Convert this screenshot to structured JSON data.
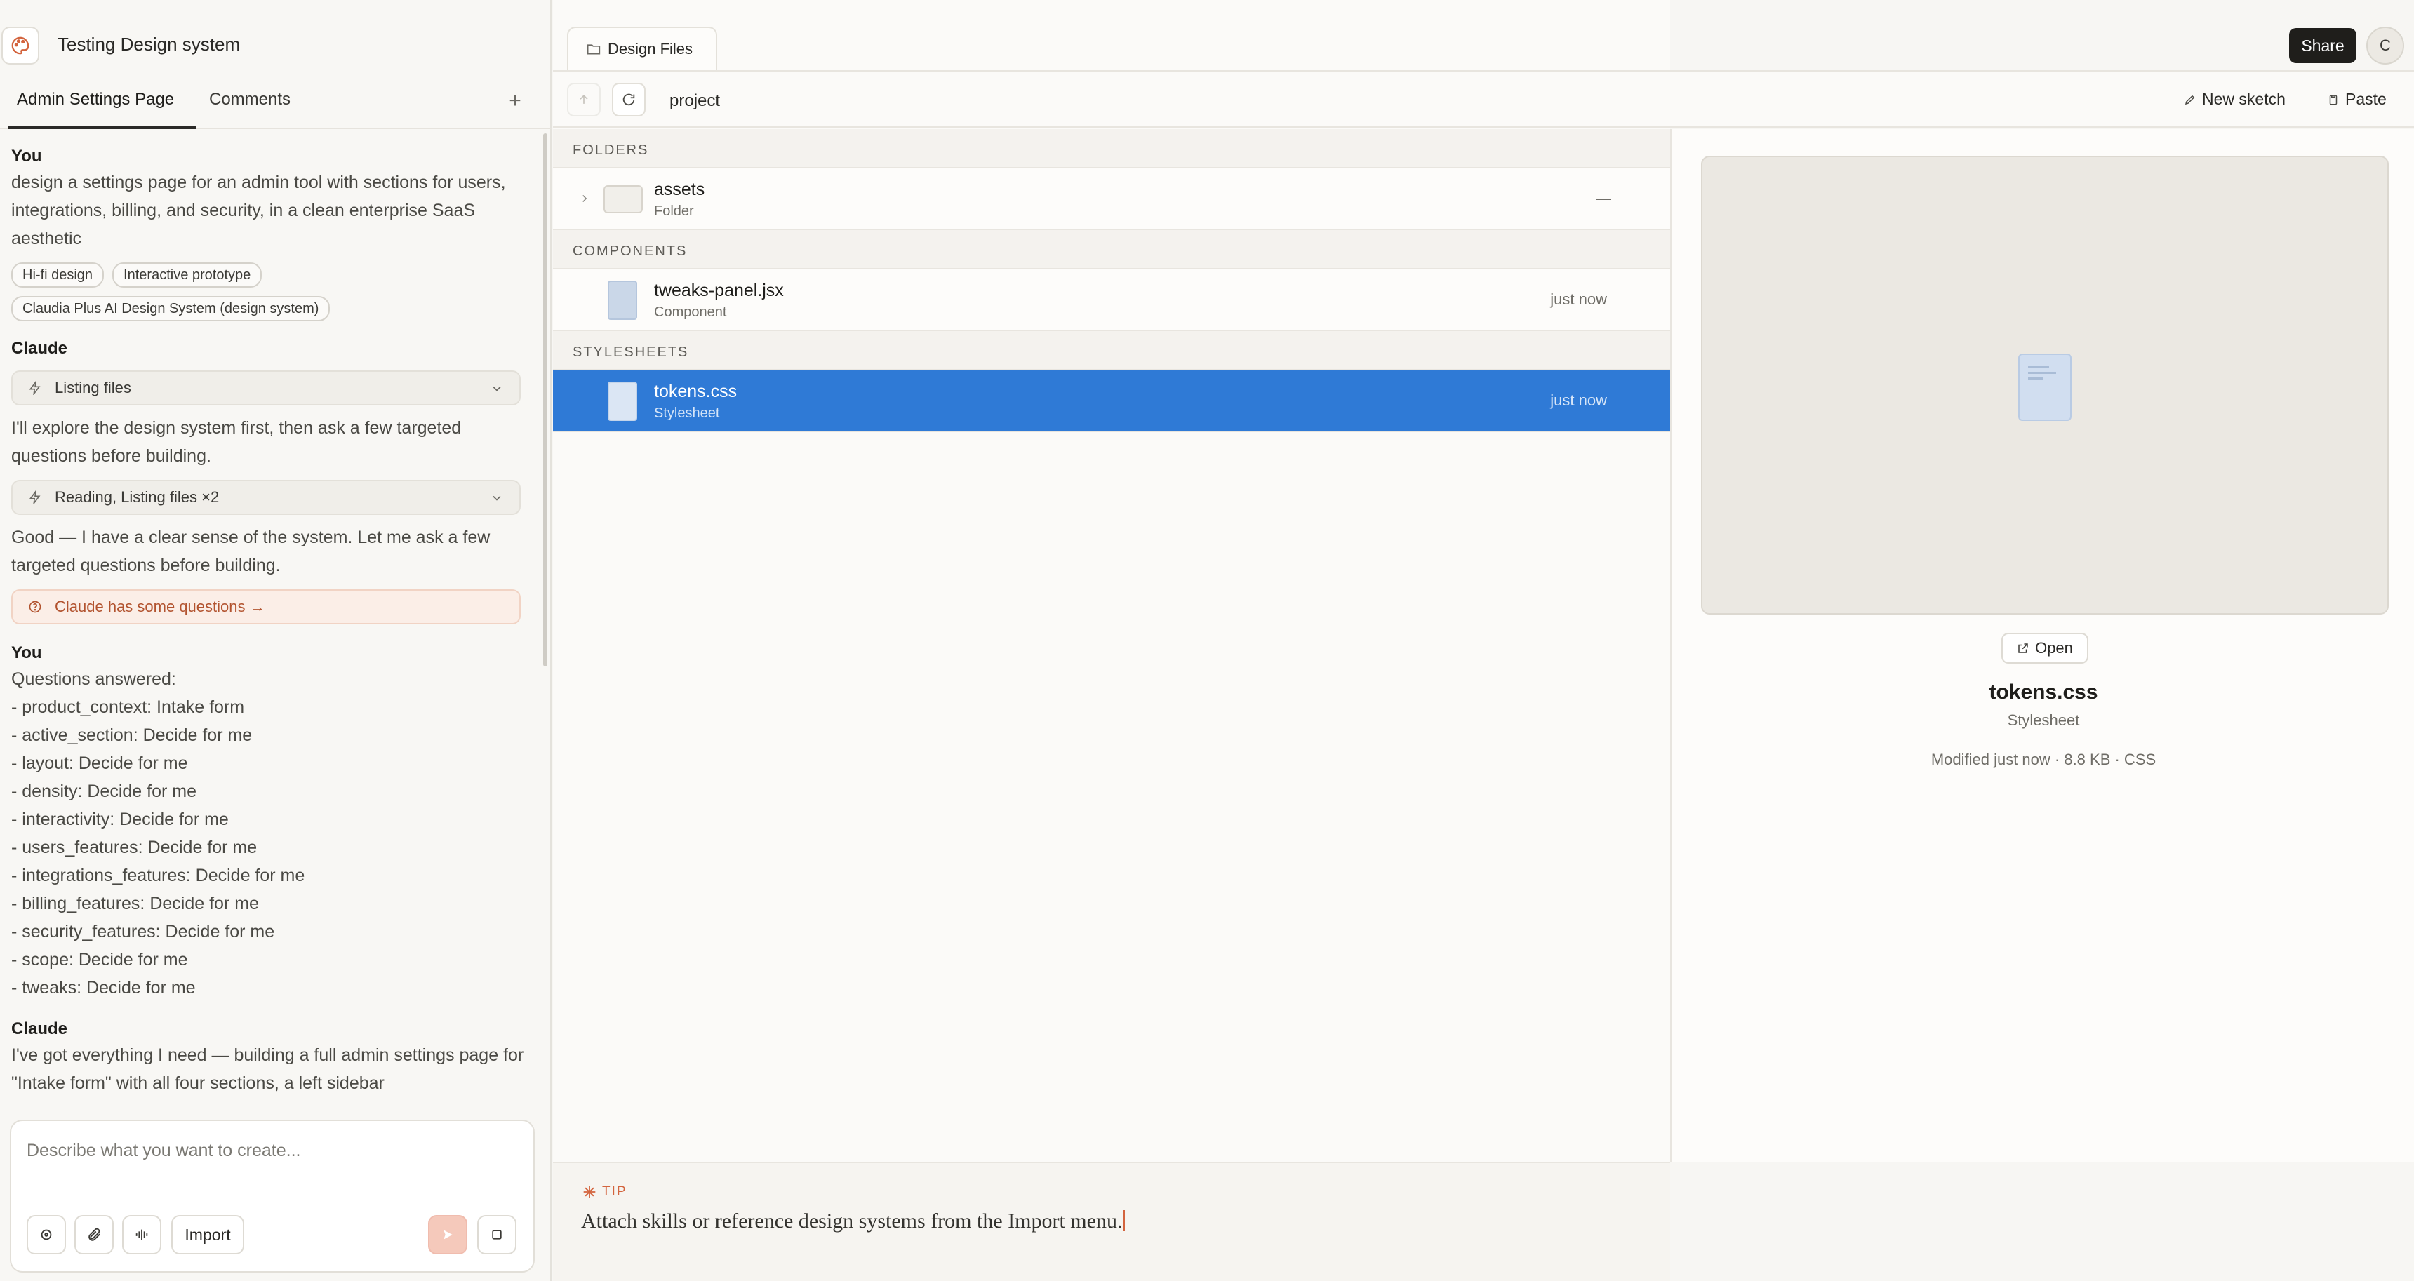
{
  "project": {
    "title": "Testing Design system"
  },
  "tabs": [
    {
      "label": "Admin Settings Page"
    },
    {
      "label": "Comments"
    }
  ],
  "chat": {
    "msg1": {
      "author": "You",
      "text": "design a settings page for an admin tool with sections for users, integrations, billing, and security, in a clean enterprise SaaS aesthetic",
      "chips": [
        "Hi-fi design",
        "Interactive prototype",
        "Claudia Plus AI Design System (design system)"
      ]
    },
    "msg2": {
      "author": "Claude",
      "tool1": "Listing files",
      "text1": "I'll explore the design system first, then ask a few targeted questions before building.",
      "tool2": "Reading, Listing files ×2",
      "text2": "Good — I have a clear sense of the system. Let me ask a few targeted questions before building.",
      "questions_link": "Claude has some questions →"
    },
    "msg3": {
      "author": "You",
      "heading": "Questions answered:",
      "answers": [
        "- product_context: Intake form",
        "- active_section: Decide for me",
        "- layout: Decide for me",
        "- density: Decide for me",
        "- interactivity: Decide for me",
        "- users_features: Decide for me",
        "- integrations_features: Decide for me",
        "- billing_features: Decide for me",
        "- security_features: Decide for me",
        "- scope: Decide for me",
        "- tweaks: Decide for me"
      ]
    },
    "msg4": {
      "author": "Claude",
      "text": "I've got everything I need — building a full admin settings page for \"Intake form\" with all four sections, a left sidebar"
    }
  },
  "composer": {
    "placeholder": "Describe what you want to create...",
    "import_label": "Import"
  },
  "files": {
    "tab_label": "Design Files",
    "breadcrumb": "project",
    "sections": [
      {
        "heading": "FOLDERS",
        "items": [
          {
            "name": "assets",
            "kind": "Folder",
            "when": "—"
          }
        ]
      },
      {
        "heading": "COMPONENTS",
        "items": [
          {
            "name": "tweaks-panel.jsx",
            "kind": "Component",
            "when": "just now"
          }
        ]
      },
      {
        "heading": "STYLESHEETS",
        "items": [
          {
            "name": "tokens.css",
            "kind": "Stylesheet",
            "when": "just now",
            "selected": true
          }
        ]
      }
    ]
  },
  "toolbar": {
    "new_sketch": "New sketch",
    "paste": "Paste",
    "share": "Share",
    "avatar_initial": "C"
  },
  "preview": {
    "open_label": "Open",
    "file_name": "tokens.css",
    "file_type": "Stylesheet",
    "meta": "Modified just now · 8.8 KB · CSS"
  },
  "tip": {
    "label": "TIP",
    "text": "Attach skills or reference design systems from the Import menu."
  },
  "colors": {
    "accent": "#2f7ad6",
    "brand_orange": "#d3643e",
    "dark": "#1f1e1b"
  }
}
